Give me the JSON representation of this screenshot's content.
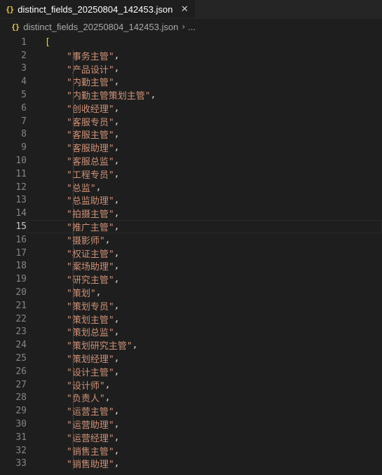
{
  "tab": {
    "icon": "{}",
    "title": "distinct_fields_20250804_142453.json",
    "close_glyph": "✕"
  },
  "breadcrumb": {
    "icon": "{}",
    "file": "distinct_fields_20250804_142453.json",
    "separator": "›",
    "more": "..."
  },
  "editor": {
    "current_line": 15,
    "open_bracket": "[",
    "lines": [
      "\"事务主管\"",
      "\"产品设计\"",
      "\"内勤主管\"",
      "\"内勤主管策划主管\"",
      "\"创收经理\"",
      "\"客服专员\"",
      "\"客服主管\"",
      "\"客服助理\"",
      "\"客服总监\"",
      "\"工程专员\"",
      "\"总监\"",
      "\"总监助理\"",
      "\"拍摄主管\"",
      "\"推广主管\"",
      "\"摄影师\"",
      "\"权证主管\"",
      "\"案场助理\"",
      "\"研究主管\"",
      "\"策划\"",
      "\"策划专员\"",
      "\"策划主管\"",
      "\"策划总监\"",
      "\"策划研究主管\"",
      "\"策划经理\"",
      "\"设计主管\"",
      "\"设计师\"",
      "\"负责人\"",
      "\"运营主管\"",
      "\"运营助理\"",
      "\"运营经理\"",
      "\"销售主管\"",
      "\"销售助理\""
    ],
    "line_numbers": [
      "1",
      "2",
      "3",
      "4",
      "5",
      "6",
      "7",
      "8",
      "9",
      "10",
      "11",
      "12",
      "13",
      "14",
      "15",
      "16",
      "17",
      "18",
      "19",
      "20",
      "21",
      "22",
      "23",
      "24",
      "25",
      "26",
      "27",
      "28",
      "29",
      "30",
      "31",
      "32",
      "33"
    ]
  },
  "colors": {
    "background": "#1e1e1e",
    "string": "#ce9178",
    "bracket": "#ffd700",
    "json_icon": "#e8c547",
    "line_number": "#858585"
  }
}
